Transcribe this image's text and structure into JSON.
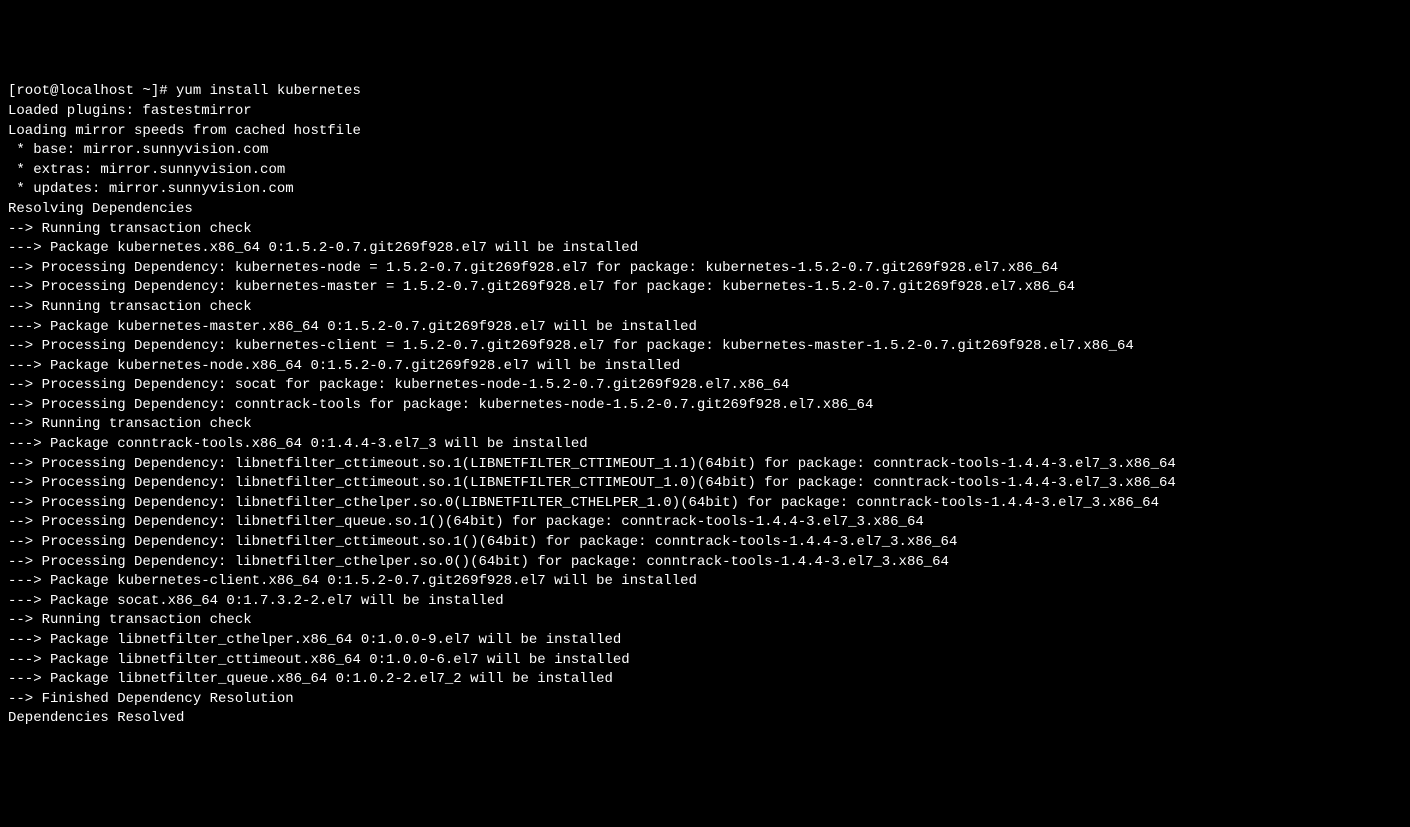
{
  "terminal": {
    "prompt": "[root@localhost ~]# ",
    "command": "yum install kubernetes",
    "lines": [
      "Loaded plugins: fastestmirror",
      "Loading mirror speeds from cached hostfile",
      " * base: mirror.sunnyvision.com",
      " * extras: mirror.sunnyvision.com",
      " * updates: mirror.sunnyvision.com",
      "Resolving Dependencies",
      "--> Running transaction check",
      "---> Package kubernetes.x86_64 0:1.5.2-0.7.git269f928.el7 will be installed",
      "--> Processing Dependency: kubernetes-node = 1.5.2-0.7.git269f928.el7 for package: kubernetes-1.5.2-0.7.git269f928.el7.x86_64",
      "--> Processing Dependency: kubernetes-master = 1.5.2-0.7.git269f928.el7 for package: kubernetes-1.5.2-0.7.git269f928.el7.x86_64",
      "--> Running transaction check",
      "---> Package kubernetes-master.x86_64 0:1.5.2-0.7.git269f928.el7 will be installed",
      "--> Processing Dependency: kubernetes-client = 1.5.2-0.7.git269f928.el7 for package: kubernetes-master-1.5.2-0.7.git269f928.el7.x86_64",
      "---> Package kubernetes-node.x86_64 0:1.5.2-0.7.git269f928.el7 will be installed",
      "--> Processing Dependency: socat for package: kubernetes-node-1.5.2-0.7.git269f928.el7.x86_64",
      "--> Processing Dependency: conntrack-tools for package: kubernetes-node-1.5.2-0.7.git269f928.el7.x86_64",
      "--> Running transaction check",
      "---> Package conntrack-tools.x86_64 0:1.4.4-3.el7_3 will be installed",
      "--> Processing Dependency: libnetfilter_cttimeout.so.1(LIBNETFILTER_CTTIMEOUT_1.1)(64bit) for package: conntrack-tools-1.4.4-3.el7_3.x86_64",
      "--> Processing Dependency: libnetfilter_cttimeout.so.1(LIBNETFILTER_CTTIMEOUT_1.0)(64bit) for package: conntrack-tools-1.4.4-3.el7_3.x86_64",
      "--> Processing Dependency: libnetfilter_cthelper.so.0(LIBNETFILTER_CTHELPER_1.0)(64bit) for package: conntrack-tools-1.4.4-3.el7_3.x86_64",
      "--> Processing Dependency: libnetfilter_queue.so.1()(64bit) for package: conntrack-tools-1.4.4-3.el7_3.x86_64",
      "--> Processing Dependency: libnetfilter_cttimeout.so.1()(64bit) for package: conntrack-tools-1.4.4-3.el7_3.x86_64",
      "--> Processing Dependency: libnetfilter_cthelper.so.0()(64bit) for package: conntrack-tools-1.4.4-3.el7_3.x86_64",
      "---> Package kubernetes-client.x86_64 0:1.5.2-0.7.git269f928.el7 will be installed",
      "---> Package socat.x86_64 0:1.7.3.2-2.el7 will be installed",
      "--> Running transaction check",
      "---> Package libnetfilter_cthelper.x86_64 0:1.0.0-9.el7 will be installed",
      "---> Package libnetfilter_cttimeout.x86_64 0:1.0.0-6.el7 will be installed",
      "---> Package libnetfilter_queue.x86_64 0:1.0.2-2.el7_2 will be installed",
      "--> Finished Dependency Resolution",
      "",
      "Dependencies Resolved"
    ]
  }
}
